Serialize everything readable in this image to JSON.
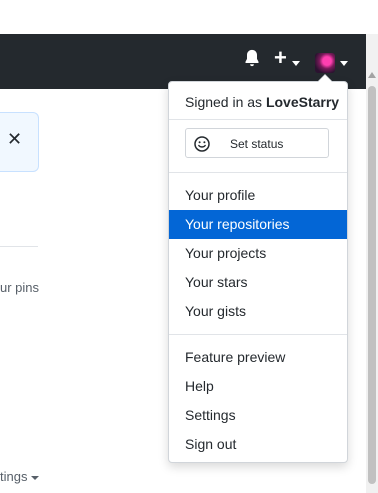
{
  "user": {
    "signed_in_prefix": "Signed in as",
    "username": "LoveStarry"
  },
  "status": {
    "label": "Set status",
    "icon": "smiley-icon"
  },
  "menu_section_1": [
    {
      "label": "Your profile",
      "active": false
    },
    {
      "label": "Your repositories",
      "active": true
    },
    {
      "label": "Your projects",
      "active": false
    },
    {
      "label": "Your stars",
      "active": false
    },
    {
      "label": "Your gists",
      "active": false
    }
  ],
  "menu_section_2": [
    {
      "label": "Feature preview"
    },
    {
      "label": "Help"
    },
    {
      "label": "Settings"
    },
    {
      "label": "Sign out"
    }
  ],
  "background": {
    "notice_close": "✕",
    "pins_text": "ur pins",
    "settings_text": "tings"
  },
  "colors": {
    "header": "#24292e",
    "accent": "#0366d6"
  }
}
